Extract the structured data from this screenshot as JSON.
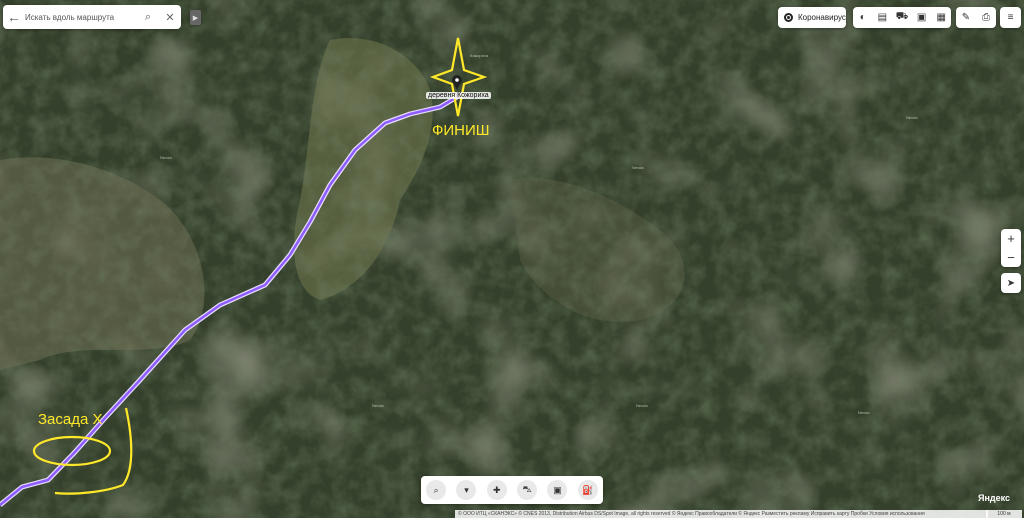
{
  "search": {
    "placeholder": "Искать вдоль маршрута"
  },
  "corona_label": "Коронавирус",
  "map": {
    "village_label": "деревня Кожориха",
    "small_labels": [
      "Кожориха",
      "Nevda",
      "Nevda",
      "Nevda",
      "Nevda",
      "Nevda",
      "Nevda"
    ],
    "route_color": "#8e5cff",
    "annotation_color": "#ffe82a"
  },
  "annotations": {
    "finish": "ФИНИШ",
    "ambush": "Засада X"
  },
  "zoom": {
    "in": "+",
    "out": "−"
  },
  "brand": "Яндекс",
  "copyright": "© ООО ИТЦ «СКАНЭКС» © CNES 2013, Distribution Airbus DS/Spot Image, all rights reserved © Яндекс   Правообладатели   © Яндекс   Разместить рекламу   Исправить карту   Пробки   Условия использования",
  "scale": "100 м",
  "icons": [
    "back-arrow-icon",
    "search-icon",
    "close-icon",
    "collapse-icon",
    "coronavirus-icon",
    "layers-icon",
    "traffic-icon",
    "panorama-icon",
    "transport-icon",
    "bus-icon",
    "metro-icon",
    "ruler-icon",
    "print-icon",
    "menu-icon",
    "geolocation-icon",
    "search-places-icon",
    "shopping-icon",
    "pharmacy-icon",
    "grocery-icon",
    "store-icon",
    "gas-station-icon",
    "location-pin-icon"
  ]
}
